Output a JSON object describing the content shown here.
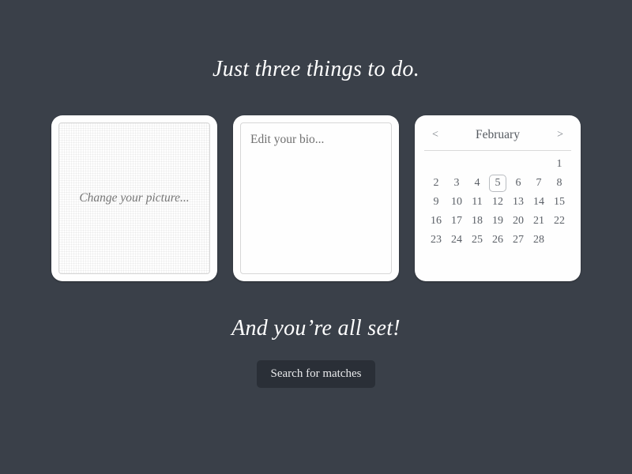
{
  "heading": "Just three things to do.",
  "subheading": "And you’re all set!",
  "picture": {
    "placeholder": "Change your picture..."
  },
  "bio": {
    "placeholder": "Edit your bio..."
  },
  "calendar": {
    "prev_label": "<",
    "next_label": ">",
    "month": "February",
    "leading_blanks": 6,
    "days_in_month": 28,
    "selected_day": 5
  },
  "search_button_label": "Search for matches"
}
